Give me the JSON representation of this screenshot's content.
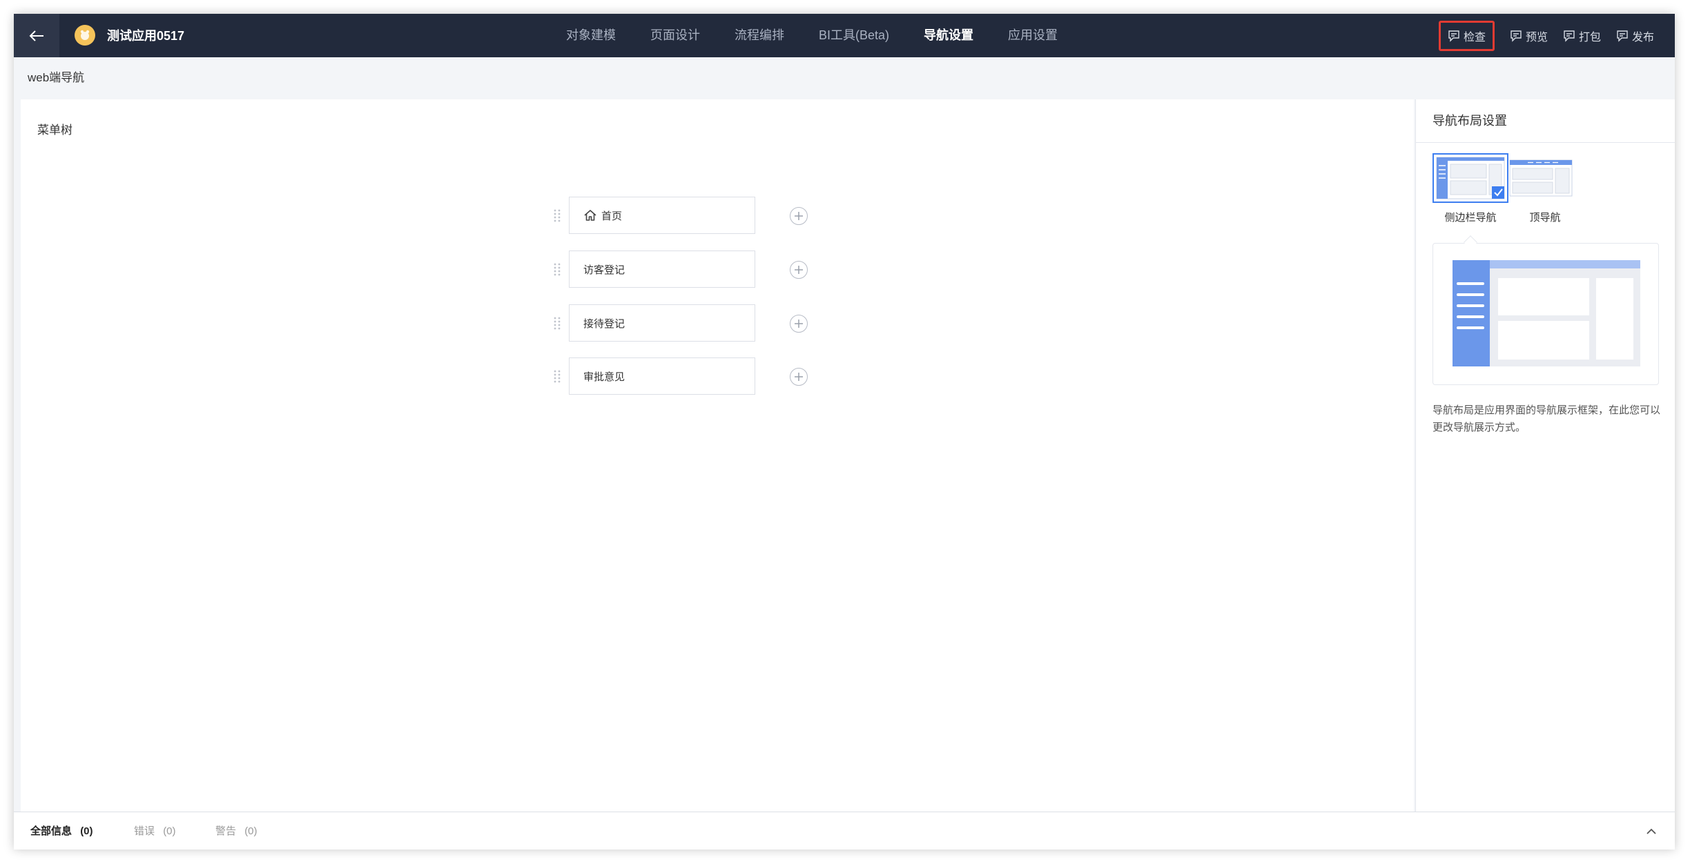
{
  "app": {
    "name": "测试应用0517",
    "icon": "app-avatar-icon",
    "accent_color": "#3d7ef0",
    "topbar_color": "#222a3c"
  },
  "main_tabs": [
    {
      "label": "对象建模",
      "active": false
    },
    {
      "label": "页面设计",
      "active": false
    },
    {
      "label": "流程编排",
      "active": false
    },
    {
      "label": "BI工具(Beta)",
      "active": false
    },
    {
      "label": "导航设置",
      "active": true
    },
    {
      "label": "应用设置",
      "active": false
    }
  ],
  "actions": [
    {
      "label": "检查",
      "icon": "check-doc-icon",
      "highlighted": true
    },
    {
      "label": "预览",
      "icon": "preview-doc-icon",
      "highlighted": false
    },
    {
      "label": "打包",
      "icon": "package-doc-icon",
      "highlighted": false
    },
    {
      "label": "发布",
      "icon": "publish-doc-icon",
      "highlighted": false
    }
  ],
  "subheader": {
    "title": "web端导航"
  },
  "menu_tree": {
    "title": "菜单树",
    "items": [
      {
        "label": "首页",
        "icon": "home-icon"
      },
      {
        "label": "访客登记"
      },
      {
        "label": "接待登记"
      },
      {
        "label": "审批意见"
      }
    ]
  },
  "layout_panel": {
    "title": "导航布局设置",
    "options": [
      {
        "label": "侧边栏导航",
        "selected": true
      },
      {
        "label": "顶导航",
        "selected": false
      }
    ],
    "description": "导航布局是应用界面的导航展示框架，在此您可以更改导航展示方式。"
  },
  "status_bar": {
    "tabs": [
      {
        "label": "全部信息",
        "count": "(0)",
        "active": true
      },
      {
        "label": "错误",
        "count": "(0)",
        "active": false
      },
      {
        "label": "警告",
        "count": "(0)",
        "active": false
      }
    ]
  }
}
